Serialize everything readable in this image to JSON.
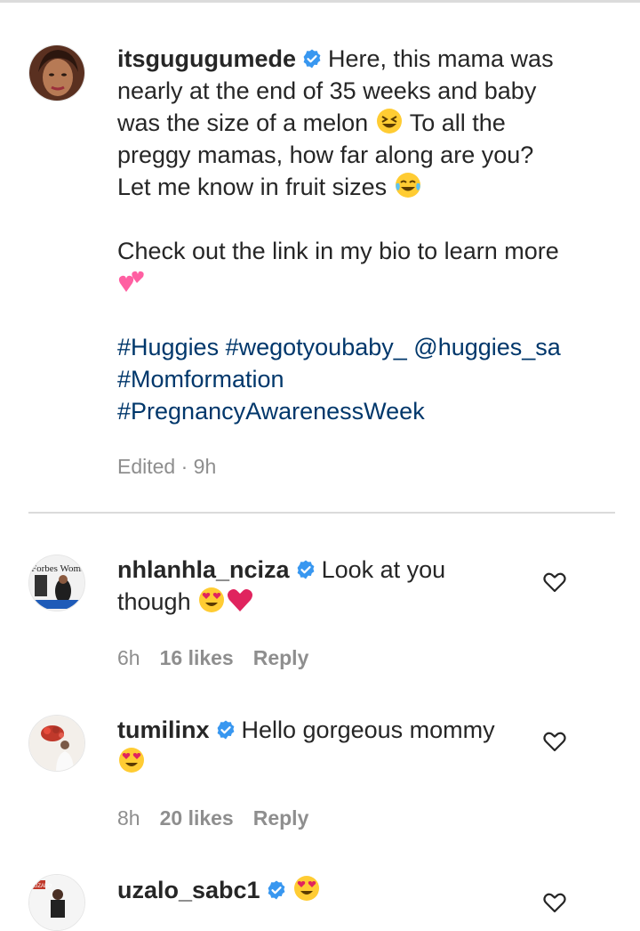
{
  "post": {
    "username": "itsgugugumede",
    "caption_line_1": "Here, this mama was nearly at the end of 35 weeks and baby was the size of a melon",
    "caption_line_2": "To all the preggy mamas, how far along are you? Let me know in fruit sizes",
    "caption_line_3": "Check out the link in my bio to learn more",
    "hashtags": [
      "#Huggies",
      "#wegotyoubaby_",
      "@huggies_sa",
      "#Momformation",
      "#PregnancyAwarenessWeek"
    ],
    "meta": "Edited · 9h",
    "icons": [
      "grinning-squinting-emoji",
      "tears-of-joy-emoji",
      "two-hearts-emoji"
    ]
  },
  "comments": [
    {
      "username": "nhlanhla_nciza",
      "text_1": "Look at you",
      "text_2": "though",
      "time": "6h",
      "likes": "16 likes",
      "reply": "Reply",
      "avatar_text": "Forbes Woman"
    },
    {
      "username": "tumilinx",
      "text": "Hello gorgeous mommy",
      "time": "8h",
      "likes": "20 likes",
      "reply": "Reply"
    },
    {
      "username": "uzalo_sabc1",
      "avatar_text": "UZALO"
    }
  ],
  "colors": {
    "text": "#262626",
    "secondary": "#8e8e8e",
    "link": "#00376b",
    "verified": "#3897f0",
    "heart_emoji": "#e0245e"
  }
}
